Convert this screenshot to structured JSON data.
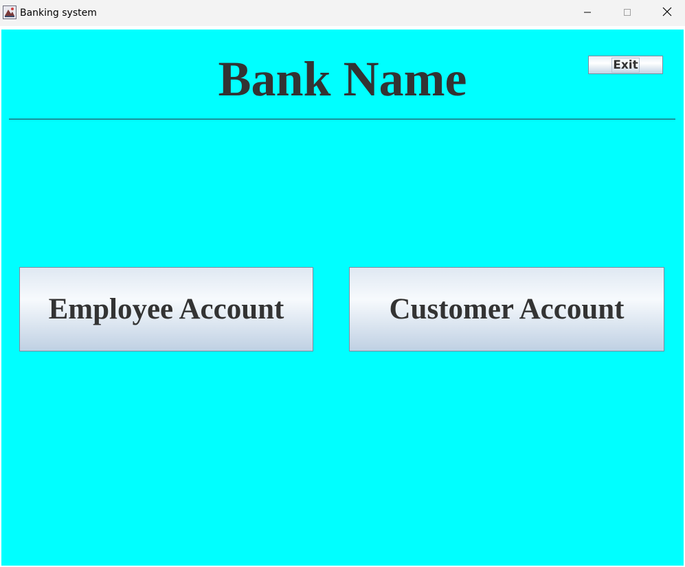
{
  "window": {
    "title": "Banking system",
    "controls": {
      "minimize": "minimize-icon",
      "maximize": "maximize-icon",
      "close": "close-icon"
    }
  },
  "header": {
    "bank_name": "Bank Name",
    "exit_label": "Exit"
  },
  "main": {
    "employee_account_label": "Employee Account",
    "customer_account_label": "Customer Account"
  },
  "colors": {
    "background": "#00ffff",
    "text": "#333333",
    "divider": "#2b3a4a"
  }
}
